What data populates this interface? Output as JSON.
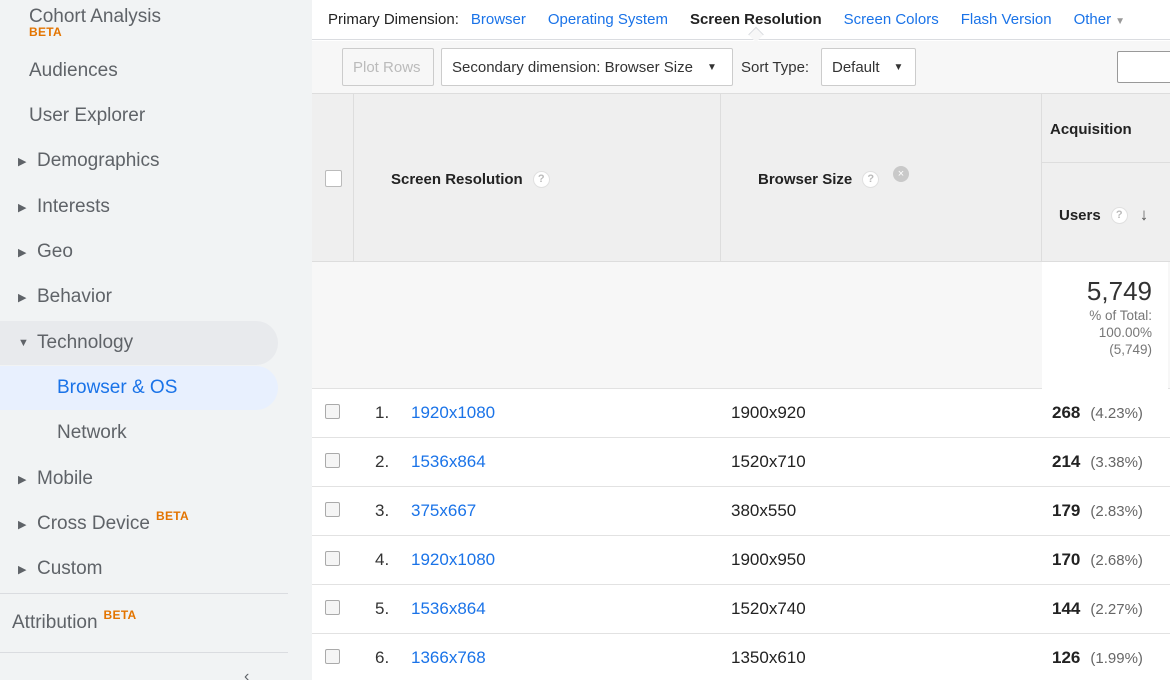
{
  "sidebar": {
    "items": [
      {
        "label": "Cohort Analysis",
        "badge": "BETA"
      },
      {
        "label": "Audiences"
      },
      {
        "label": "User Explorer"
      },
      {
        "label": "Demographics"
      },
      {
        "label": "Interests"
      },
      {
        "label": "Geo"
      },
      {
        "label": "Behavior"
      },
      {
        "label": "Technology"
      },
      {
        "label": "Browser & OS"
      },
      {
        "label": "Network"
      },
      {
        "label": "Mobile"
      },
      {
        "label": "Cross Device",
        "badge": "BETA"
      },
      {
        "label": "Custom"
      },
      {
        "label": "Attribution",
        "badge": "BETA"
      }
    ]
  },
  "dimbar": {
    "label": "Primary Dimension:",
    "browser": "Browser",
    "os": "Operating System",
    "current": "Screen Resolution",
    "colors": "Screen Colors",
    "flash": "Flash Version",
    "other": "Other"
  },
  "toolbar": {
    "plot_rows": "Plot Rows",
    "secondary": "Secondary dimension: Browser Size",
    "sort_label": "Sort Type:",
    "sort_value": "Default"
  },
  "table": {
    "col_resolution": "Screen Resolution",
    "col_browser_size": "Browser Size",
    "group_acquisition": "Acquisition",
    "col_users": "Users",
    "help_glyph": "?",
    "remove_glyph": "×",
    "totals": {
      "users": "5,749",
      "pct_label": "% of Total:",
      "pct_value": "100.00%",
      "abs_value": "(5,749)"
    },
    "rows": [
      {
        "idx": "1.",
        "resolution": "1920x1080",
        "browser_size": "1900x920",
        "users": "268",
        "pct": "(4.23%)"
      },
      {
        "idx": "2.",
        "resolution": "1536x864",
        "browser_size": "1520x710",
        "users": "214",
        "pct": "(3.38%)"
      },
      {
        "idx": "3.",
        "resolution": "375x667",
        "browser_size": "380x550",
        "users": "179",
        "pct": "(2.83%)"
      },
      {
        "idx": "4.",
        "resolution": "1920x1080",
        "browser_size": "1900x950",
        "users": "170",
        "pct": "(2.68%)"
      },
      {
        "idx": "5.",
        "resolution": "1536x864",
        "browser_size": "1520x740",
        "users": "144",
        "pct": "(2.27%)"
      },
      {
        "idx": "6.",
        "resolution": "1366x768",
        "browser_size": "1350x610",
        "users": "126",
        "pct": "(1.99%)"
      }
    ]
  },
  "colors": {
    "link": "#1a73e8",
    "beta": "#e37400",
    "sidebar_bg": "#f1f3f4",
    "active_bg": "#e8f0fe"
  }
}
